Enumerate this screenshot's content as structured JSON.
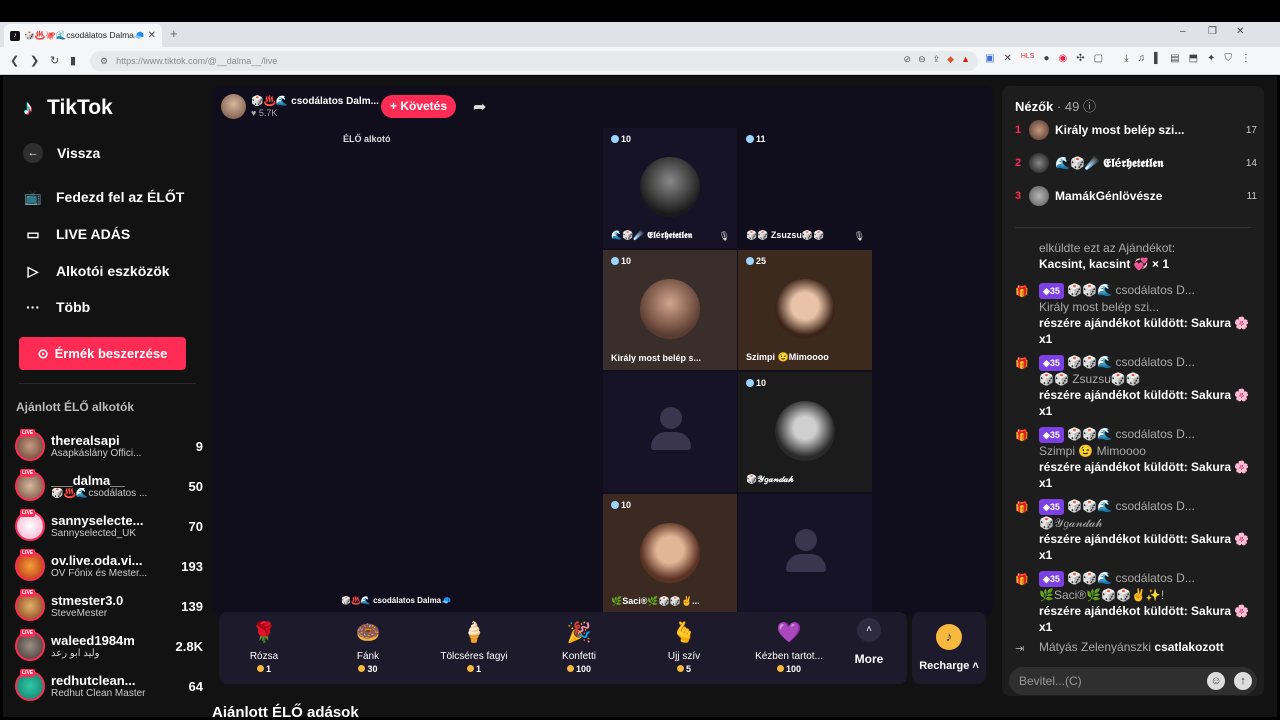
{
  "browser": {
    "tab_title": "🎲♨️🐙🌊csodálatos Dalma🧢",
    "url": "https://www.tiktok.com/@__dalma__/live"
  },
  "sidebar": {
    "logo": "TikTok",
    "back": "Vissza",
    "menu": [
      {
        "label": "Fedezd fel az ÉLŐT",
        "icon": "tv-icon"
      },
      {
        "label": "LIVE ADÁS",
        "icon": "camera-icon"
      },
      {
        "label": "Alkotói eszközök",
        "icon": "play-icon"
      },
      {
        "label": "Több",
        "icon": "dots-icon"
      }
    ],
    "coins_button": "Érmék beszerzése",
    "suggested_title": "Ajánlott ÉLŐ alkotók",
    "live_badge": "LIVE",
    "creators": [
      {
        "name": "therealsapi",
        "sub": "Asapkáslány Offici...",
        "count": "9"
      },
      {
        "name": "___dalma__",
        "sub": "🎲♨️🌊csodálatos ...",
        "count": "50"
      },
      {
        "name": "sannyselecte...",
        "sub": "Sannyselected_UK",
        "count": "70"
      },
      {
        "name": "ov.live.oda.vi...",
        "sub": "OV Főnix és Mester...",
        "count": "193"
      },
      {
        "name": "stmester3.0",
        "sub": "SteveMester",
        "count": "139"
      },
      {
        "name": "waleed1984m",
        "sub": "وليد ابو رعد",
        "count": "2.8K"
      },
      {
        "name": "redhutclean...",
        "sub": "Redhut Clean Master",
        "count": "64"
      }
    ]
  },
  "host": {
    "name": "🎲♨️🌊 csodálatos Dalm...",
    "likes": "5.7K",
    "follow": "+ Követés",
    "creator_tag": "ÉLŐ alkotó",
    "bottom_name": "🎲♨️🌊 csodálatos Dalma🧢"
  },
  "guests": [
    {
      "score": "10",
      "name": "🌊🎲☄️ 𝕰𝖑é𝖗𝖍𝖊𝖙𝖊𝖙𝖑𝖊𝖓",
      "mute": true
    },
    {
      "score": "11",
      "name": "🎲🎲 Zsuzsu🎲🎲",
      "mute": true
    },
    {
      "score": "10",
      "name": "Király most belép s..."
    },
    {
      "score": "25",
      "name": "Szimpi 😉Mimoooo"
    },
    {
      "score": "",
      "name": ""
    },
    {
      "score": "10",
      "name": "🎲𝒴𝑔𝒶𝓃𝒹𝒶𝒽"
    },
    {
      "score": "10",
      "name": "🌿Saci®🌿🎲🎲✌️..."
    },
    {
      "score": "",
      "name": ""
    }
  ],
  "gifts": [
    {
      "name": "Rózsa",
      "price": "1",
      "icon": "🌹"
    },
    {
      "name": "Fánk",
      "price": "30",
      "icon": "🍩"
    },
    {
      "name": "Tölcséres fagyi",
      "price": "1",
      "icon": "🍦"
    },
    {
      "name": "Konfetti",
      "price": "100",
      "icon": "🎉"
    },
    {
      "name": "Ujj szív",
      "price": "5",
      "icon": "🫰"
    },
    {
      "name": "Kézben tartot...",
      "price": "100",
      "icon": "💜"
    }
  ],
  "more_label": "More",
  "recharge_label": "Recharge ˄",
  "recommended_title": "Ajánlott ÉLŐ adások",
  "chat": {
    "viewers_title": "Nézők",
    "viewers_count": "· 49",
    "viewers": [
      {
        "rank": "1",
        "name": "Király most belép szi...",
        "score": "17"
      },
      {
        "rank": "2",
        "name": "🌊🎲☄️ 𝕰𝖑é𝖗𝖍𝖊𝖙𝖊𝖙𝖑𝖊𝖓",
        "score": "14"
      },
      {
        "rank": "3",
        "name": "MamákGénlövésze",
        "score": "11"
      }
    ],
    "partial_msg_1": "elküldte ezt az Ajándékot:",
    "partial_msg_2": "Kacsint, kacsint 💞 × 1",
    "messages": [
      {
        "badge": "35",
        "sender": "🎲🎲🌊 csodálatos D...",
        "target": "Király most belép szi...",
        "text": "részére ajándékot küldött: Sakura 🌸 x1"
      },
      {
        "badge": "35",
        "sender": "🎲🎲🌊 csodálatos D...",
        "target": "🎲🎲 Zsuzsu🎲🎲",
        "text": "részére ajándékot küldött: Sakura 🌸 x1"
      },
      {
        "badge": "35",
        "sender": "🎲🎲🌊 csodálatos D...",
        "target": "Szimpi 😉 Mimoooo",
        "text": "részére ajándékot küldött: Sakura 🌸 x1"
      },
      {
        "badge": "35",
        "sender": "🎲🎲🌊 csodálatos D...",
        "target": "🎲𝒴𝑔𝒶𝓃𝒹𝒶𝒽",
        "text": "részére ajándékot küldött: Sakura 🌸 x1"
      },
      {
        "badge": "35",
        "sender": "🎲🎲🌊 csodálatos D...",
        "target": "🌿Saci®🌿🎲🎲✌️✨!",
        "text": "részére ajándékot küldött: Sakura 🌸 x1"
      }
    ],
    "join_user": "Mátyás Zelenyánszki",
    "join_text": "csatlakozott",
    "input_placeholder": "Bevitel...(C)"
  }
}
